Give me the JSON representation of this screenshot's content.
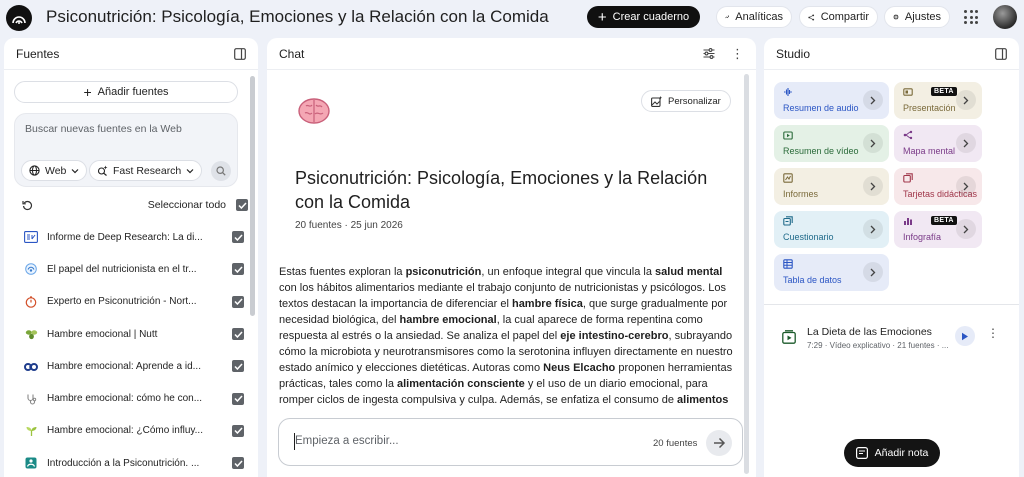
{
  "header": {
    "title": "Psiconutrición: Psicología, Emociones y la Relación con la Comida",
    "create_label": "Crear cuaderno",
    "analytics_label": "Analíticas",
    "share_label": "Compartir",
    "settings_label": "Ajustes"
  },
  "sources": {
    "title": "Fuentes",
    "add_label": "Añadir fuentes",
    "search_placeholder": "Buscar nuevas fuentes en la Web",
    "web_chip": "Web",
    "research_chip": "Fast Research",
    "select_all": "Seleccionar todo",
    "items": [
      {
        "name": "Informe de Deep Research: La di..."
      },
      {
        "name": "El papel del nutricionista en el tr..."
      },
      {
        "name": "Experto en Psiconutrición - Nort..."
      },
      {
        "name": "Hambre emocional | Nutt"
      },
      {
        "name": "Hambre emocional: Aprende a id..."
      },
      {
        "name": "Hambre emocional: cómo he con..."
      },
      {
        "name": "Hambre emocional: ¿Cómo influy..."
      },
      {
        "name": "Introducción a la Psiconutrición. ..."
      }
    ]
  },
  "chat": {
    "title": "Chat",
    "personalize_label": "Personalizar",
    "notebook_title": "Psiconutrición: Psicología, Emociones y la Relación con la Comida",
    "meta": "20 fuentes · 25 jun 2026",
    "summary": [
      {
        "t": "Estas fuentes exploran la "
      },
      {
        "t": "psiconutrición",
        "b": true
      },
      {
        "t": ", un enfoque integral que vincula la "
      },
      {
        "t": "salud mental",
        "b": true
      },
      {
        "t": " con los hábitos alimentarios mediante el trabajo conjunto de nutricionistas y psicólogos. Los textos destacan la importancia de diferenciar el "
      },
      {
        "t": "hambre física",
        "b": true
      },
      {
        "t": ", que surge gradualmente por necesidad biológica, del "
      },
      {
        "t": "hambre emocional",
        "b": true
      },
      {
        "t": ", la cual aparece de forma repentina como respuesta al estrés o la ansiedad. Se analiza el papel del "
      },
      {
        "t": "eje intestino-cerebro",
        "b": true
      },
      {
        "t": ", subrayando cómo la microbiota y neurotransmisores como la serotonina influyen directamente en nuestro estado anímico y elecciones dietéticas. Autoras como "
      },
      {
        "t": "Neus Elcacho",
        "b": true
      },
      {
        "t": " proponen herramientas prácticas, tales como la "
      },
      {
        "t": "alimentación consciente",
        "b": true
      },
      {
        "t": " y el uso de un diario emocional, para romper ciclos de ingesta compulsiva y culpa. Además, se enfatiza el consumo de "
      },
      {
        "t": "alimentos",
        "b": true
      }
    ],
    "input_placeholder": "Empieza a escribir...",
    "source_count": "20 fuentes"
  },
  "studio": {
    "title": "Studio",
    "beta_label": "BETA",
    "tiles": [
      {
        "label": "Resumen de audio",
        "color": "#e6ebf8",
        "fg": "#2b56c4",
        "beta": false
      },
      {
        "label": "Presentación",
        "color": "#f3efe3",
        "fg": "#7a6a3a",
        "beta": true
      },
      {
        "label": "Resumen de vídeo",
        "color": "#e4f1e6",
        "fg": "#2b6b3a",
        "beta": false
      },
      {
        "label": "Mapa mental",
        "color": "#f1e8f3",
        "fg": "#7a3a88",
        "beta": false
      },
      {
        "label": "Informes",
        "color": "#f3efe3",
        "fg": "#7a6a3a",
        "beta": false
      },
      {
        "label": "Tarjetas didácticas",
        "color": "#f7e8ea",
        "fg": "#a0364a",
        "beta": false
      },
      {
        "label": "Cuestionario",
        "color": "#e2f0f6",
        "fg": "#1f6a8a",
        "beta": false
      },
      {
        "label": "Infografía",
        "color": "#f1e8f3",
        "fg": "#7a3a88",
        "beta": true
      },
      {
        "label": "Tabla de datos",
        "color": "#e6ebf8",
        "fg": "#2b56c4",
        "beta": false
      }
    ],
    "note_title": "La Dieta de las Emociones",
    "note_sub": "7:29 · Vídeo explicativo · 21 fuentes · ...",
    "add_note_label": "Añadir nota"
  }
}
